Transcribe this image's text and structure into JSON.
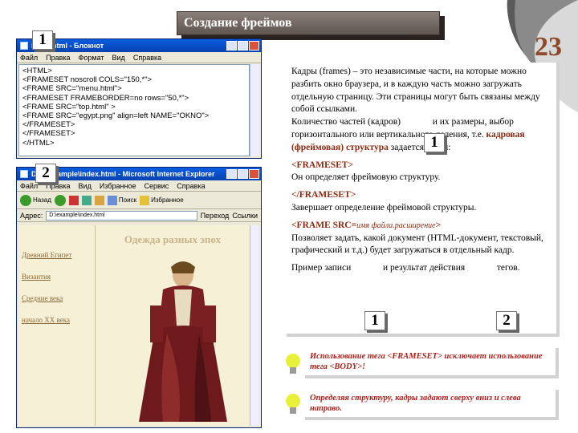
{
  "slide": {
    "title": "Создание фреймов",
    "page_number": "23"
  },
  "notepad": {
    "title": "index.html - Блокнот",
    "menu": [
      "Файл",
      "Правка",
      "Формат",
      "Вид",
      "Справка"
    ],
    "code_lines": [
      "<HTML>",
      "<FRAMESET noscroll COLS=\"150,*\">",
      "<FRAME SRC=\"menu.html\">",
      "<FRAMESET FRAMEBORDER=no rows=\"50,*\">",
      "<FRAME SRC=\"top.html\" >",
      "<FRAME SRC=\"egypt.png\" align=left NAME=\"OKNO\">",
      "</FRAMESET>",
      "</FRAMESET>",
      "</HTML>"
    ]
  },
  "browser": {
    "title": "D:\\...\\example\\index.html - Microsoft Internet Explorer",
    "menu": [
      "Файл",
      "Правка",
      "Вид",
      "Избранное",
      "Сервис",
      "Справка"
    ],
    "toolbar": {
      "back": "Назад",
      "search": "Поиск",
      "favorites": "Избранное"
    },
    "address_label": "Адрес:",
    "address_value": "D:\\example\\index.html",
    "go_label": "Переход",
    "links_label": "Ссылки",
    "page_heading": "Одежда разных эпох",
    "nav_links": [
      "Древний Египет",
      "Византия",
      "Средние века",
      "начало XX века"
    ]
  },
  "badges": {
    "one": "1",
    "two": "2"
  },
  "content": {
    "p1_a": "Кадры (frames) – это независимые части, на которые можно разбить окно браузера, и в каждую часть можно загружать отдельную страницу. Эти страницы могут быть связаны между собой ссылками.",
    "p1_b": "Количество частей (кадров)",
    "p1_c": "и их размеры, выбор горизонтального или вертикального деления, т.е.",
    "p1_d": "кадровая (фреймовая) структура",
    "p1_e": "задается тегом:",
    "tag1": "<FRAMESET>",
    "tag1_desc": "Он определяет фреймовую структуру.",
    "tag2": "</FRAMESET>",
    "tag2_desc": "Завершает определение фреймовой структуры.",
    "tag3": "<FRAME SRC=",
    "tag3_italic": "имя файла.расширение",
    "tag3_end": ">",
    "tag3_desc": "Позволяет задать, какой документ (HTML-документ, текстовый, графический и т.д.) будет загружаться в отдельный кадр.",
    "example_a": "Пример записи",
    "example_b": "и результат действия",
    "example_c": "тегов."
  },
  "notes": [
    "Использование тега <FRAMESET> исключает использование тега <BODY>!",
    "Определяя структуру, кадры задают сверху вниз и слева направо."
  ],
  "colors": {
    "accent": "#8b2a10",
    "note": "#b0201a",
    "title_bg": "#6f6560",
    "page_number": "#8b4a2b"
  }
}
